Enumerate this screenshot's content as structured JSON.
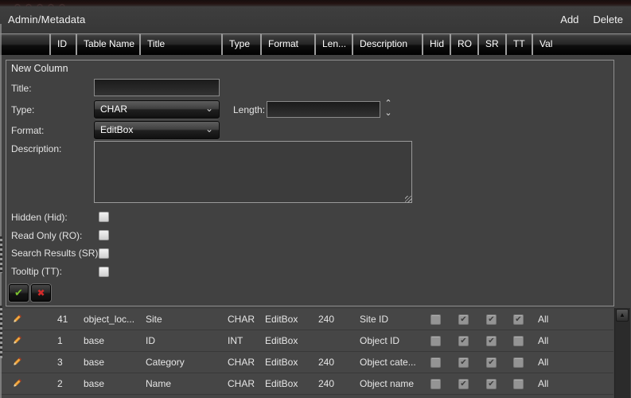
{
  "titlebar": {
    "title": "Admin/Metadata",
    "add_label": "Add",
    "delete_label": "Delete"
  },
  "grid": {
    "headers": [
      "",
      "ID",
      "Table Name",
      "Title",
      "Type",
      "Format",
      "Len...",
      "Description",
      "Hid",
      "RO",
      "SR",
      "TT",
      "Val"
    ],
    "rows": [
      {
        "id": "41",
        "table_name": "object_loc...",
        "title": "Site",
        "type": "CHAR",
        "format": "EditBox",
        "len": "240",
        "description": "Site ID",
        "hid": false,
        "ro": true,
        "sr": true,
        "tt": true,
        "val": "All"
      },
      {
        "id": "1",
        "table_name": "base",
        "title": "ID",
        "type": "INT",
        "format": "EditBox",
        "len": "",
        "description": "Object ID",
        "hid": false,
        "ro": true,
        "sr": true,
        "tt": false,
        "val": "All"
      },
      {
        "id": "3",
        "table_name": "base",
        "title": "Category",
        "type": "CHAR",
        "format": "EditBox",
        "len": "240",
        "description": "Object cate...",
        "hid": false,
        "ro": true,
        "sr": true,
        "tt": false,
        "val": "All"
      },
      {
        "id": "2",
        "table_name": "base",
        "title": "Name",
        "type": "CHAR",
        "format": "EditBox",
        "len": "240",
        "description": "Object name",
        "hid": false,
        "ro": true,
        "sr": true,
        "tt": false,
        "val": "All"
      }
    ]
  },
  "form": {
    "panel_title": "New Column",
    "title_label": "Title:",
    "title_value": "",
    "type_label": "Type:",
    "type_value": "CHAR",
    "length_label": "Length:",
    "length_value": "",
    "format_label": "Format:",
    "format_value": "EditBox",
    "description_label": "Description:",
    "description_value": "",
    "hidden_label": "Hidden (Hid):",
    "readonly_label": "Read Only (RO):",
    "search_results_label": "Search Results (SR):",
    "tooltip_label": "Tooltip (TT):",
    "confirm_glyph": "✔",
    "cancel_glyph": "✖"
  },
  "icons": {
    "select_chevron": "⌄",
    "spinner_up": "⌃",
    "spinner_down": "⌄",
    "scroll_up": "▲"
  },
  "colors": {
    "confirm_green": "#7cc32f",
    "cancel_red": "#d42b2b",
    "header_separator": "#9c9c9c",
    "row_background": "#464646"
  }
}
